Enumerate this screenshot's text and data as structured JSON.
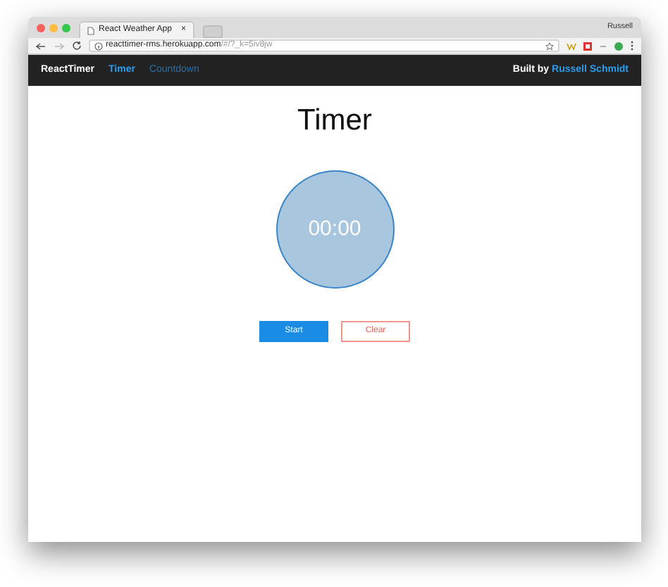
{
  "browser": {
    "tab_title": "React Weather App",
    "tab_close": "×",
    "user": "Russell",
    "url_host": "reacttimer-rms.herokuapp.com",
    "url_rest": "/#/?_k=5iv8jw"
  },
  "navbar": {
    "brand": "ReactTimer",
    "links": [
      {
        "label": "Timer",
        "selected": true
      },
      {
        "label": "Countdown",
        "selected": false
      }
    ],
    "credit_prefix": "Built by",
    "credit_link": "Russell Schmidt"
  },
  "page": {
    "title": "Timer",
    "clock": "00:00",
    "buttons": [
      {
        "label": "Start",
        "kind": "primary"
      },
      {
        "label": "Clear",
        "kind": "outline"
      }
    ]
  }
}
